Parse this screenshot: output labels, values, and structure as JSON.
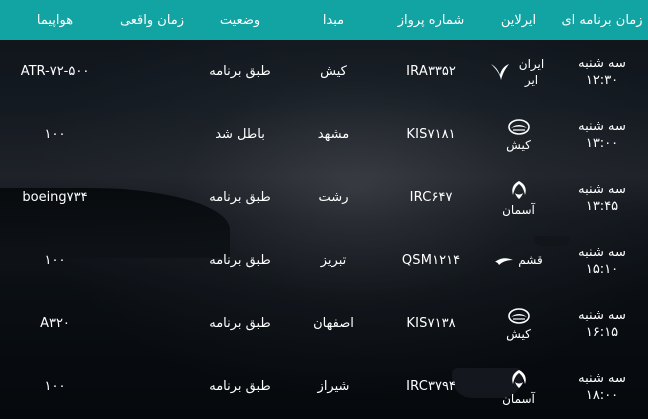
{
  "header": {
    "columns": [
      "زمان برنامه ای",
      "ایرلاین",
      "شماره پرواز",
      "مبدا",
      "وضعیت",
      "زمان واقعی",
      "هواپیما"
    ]
  },
  "flights": [
    {
      "day": "سه شنبه",
      "time": "۱۲:۳۰",
      "airline": "ایران ایر",
      "airline_icon": "iran-air-logo-icon",
      "flight_no": "IRA۳۳۵۲",
      "origin": "کیش",
      "status": "طبق برنامه",
      "actual": "",
      "aircraft": "ATR-۷۲-۵۰۰"
    },
    {
      "day": "سه شنبه",
      "time": "۱۳:۰۰",
      "airline": "کیش",
      "airline_icon": "kish-air-logo-icon",
      "flight_no": "KIS۷۱۸۱",
      "origin": "مشهد",
      "status": "باطل شد",
      "actual": "",
      "aircraft": "۱۰۰"
    },
    {
      "day": "سه شنبه",
      "time": "۱۳:۴۵",
      "airline": "آسمان",
      "airline_icon": "aseman-logo-icon",
      "flight_no": "IRC۶۴۷",
      "origin": "رشت",
      "status": "طبق برنامه",
      "actual": "",
      "aircraft": "boeing۷۳۴"
    },
    {
      "day": "سه شنبه",
      "time": "۱۵:۱۰",
      "airline": "قشم",
      "airline_icon": "qeshm-air-logo-icon",
      "flight_no": "QSM۱۲۱۴",
      "origin": "تبریز",
      "status": "طبق برنامه",
      "actual": "",
      "aircraft": "۱۰۰"
    },
    {
      "day": "سه شنبه",
      "time": "۱۶:۱۵",
      "airline": "کیش",
      "airline_icon": "kish-air-logo-icon",
      "flight_no": "KIS۷۱۳۸",
      "origin": "اصفهان",
      "status": "طبق برنامه",
      "actual": "",
      "aircraft": "A۳۲۰"
    },
    {
      "day": "سه شنبه",
      "time": "۱۸:۰۰",
      "airline": "آسمان",
      "airline_icon": "aseman-logo-icon",
      "flight_no": "IRC۳۷۹۴",
      "origin": "شیراز",
      "status": "طبق برنامه",
      "actual": "",
      "aircraft": "۱۰۰"
    }
  ]
}
